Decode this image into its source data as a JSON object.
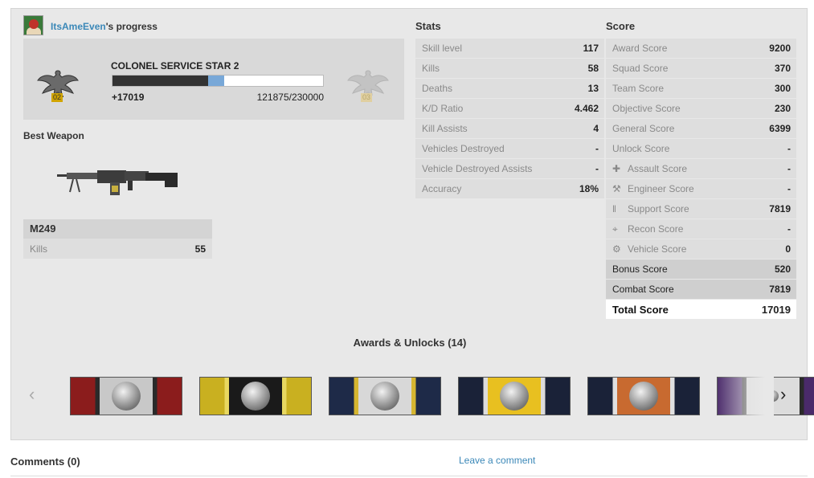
{
  "header": {
    "username": "ItsAmeEven",
    "title_suffix": "'s progress"
  },
  "rank": {
    "name": "COLONEL SERVICE STAR 2",
    "current_code": "02",
    "next_code": "03",
    "xp_gain": "+17019",
    "xp_progress": "121875/230000",
    "xp_fraction": 0.53,
    "gain_fraction": 0.074
  },
  "best_weapon": {
    "title": "Best Weapon",
    "name": "M249",
    "kills_label": "Kills",
    "kills_value": "55"
  },
  "stats": {
    "title": "Stats",
    "rows": [
      {
        "label": "Skill level",
        "value": "117"
      },
      {
        "label": "Kills",
        "value": "58"
      },
      {
        "label": "Deaths",
        "value": "13"
      },
      {
        "label": "K/D Ratio",
        "value": "4.462"
      },
      {
        "label": "Kill Assists",
        "value": "4"
      },
      {
        "label": "Vehicles Destroyed",
        "value": "-"
      },
      {
        "label": "Vehicle Destroyed Assists",
        "value": "-"
      },
      {
        "label": "Accuracy",
        "value": "18%"
      }
    ]
  },
  "score": {
    "title": "Score",
    "rows": [
      {
        "label": "Award Score",
        "value": "9200",
        "icon": ""
      },
      {
        "label": "Squad Score",
        "value": "370",
        "icon": ""
      },
      {
        "label": "Team Score",
        "value": "300",
        "icon": ""
      },
      {
        "label": "Objective Score",
        "value": "230",
        "icon": ""
      },
      {
        "label": "General Score",
        "value": "6399",
        "icon": ""
      },
      {
        "label": "Unlock Score",
        "value": "-",
        "icon": ""
      },
      {
        "label": "Assault Score",
        "value": "-",
        "icon": "assault-icon"
      },
      {
        "label": "Engineer Score",
        "value": "-",
        "icon": "engineer-icon"
      },
      {
        "label": "Support Score",
        "value": "7819",
        "icon": "support-icon"
      },
      {
        "label": "Recon Score",
        "value": "-",
        "icon": "recon-icon"
      },
      {
        "label": "Vehicle Score",
        "value": "0",
        "icon": "vehicle-icon"
      },
      {
        "label": "Bonus Score",
        "value": "520",
        "icon": ""
      },
      {
        "label": "Combat Score",
        "value": "7819",
        "icon": ""
      }
    ],
    "total_label": "Total Score",
    "total_value": "17019"
  },
  "awards": {
    "title": "Awards & Unlocks (14)",
    "ribbons": [
      {
        "name": "ribbon-1",
        "colors": [
          "#8b1c1c",
          "#c8c8c8",
          "#2a2a2a"
        ]
      },
      {
        "name": "ribbon-2",
        "colors": [
          "#c9b020",
          "#1a1a1a",
          "#e8d860"
        ]
      },
      {
        "name": "ribbon-3",
        "colors": [
          "#1e2a48",
          "#d8d8d8",
          "#d6b630"
        ]
      },
      {
        "name": "ribbon-4",
        "colors": [
          "#1a2238",
          "#e8c020",
          "#dcdcdc"
        ]
      },
      {
        "name": "ribbon-5",
        "colors": [
          "#1a2238",
          "#c86a30",
          "#e0e0e0"
        ]
      },
      {
        "name": "ribbon-6",
        "colors": [
          "#4a2a6a",
          "#dcdcdc",
          "#2a2a2a"
        ]
      }
    ]
  },
  "comments": {
    "title": "Comments (0)",
    "leave_label": "Leave a comment"
  }
}
